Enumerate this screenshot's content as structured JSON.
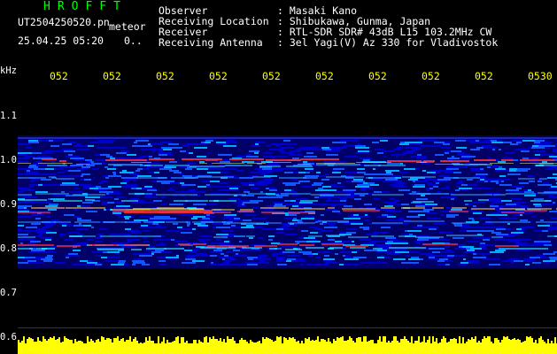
{
  "header": {
    "brand": "HROFFT",
    "filename": "UT2504250520.pn",
    "mode": "meteor",
    "datetime": "25.04.25 05:20",
    "zero_field": "0..",
    "fields": [
      {
        "label": "Observer",
        "value": ": Masaki Kano"
      },
      {
        "label": "Receiving Location",
        "value": ": Shibukawa, Gunma, Japan"
      },
      {
        "label": "Receiver",
        "value": ": RTL-SDR SDR# 43dB L15 103.2MHz CW"
      },
      {
        "label": "Receiving Antenna",
        "value": ": 3el Yagi(V) Az 330 for Vladivostok"
      }
    ]
  },
  "axis": {
    "unit": "kHz",
    "y_ticks": [
      "1.1",
      "1.0",
      "0.9",
      "0.8",
      "0.7",
      "0.6"
    ],
    "x_ticks": [
      "052",
      "052",
      "052",
      "052",
      "052",
      "052",
      "052",
      "052",
      "052",
      "0530"
    ]
  },
  "colors": {
    "brand": "#00ff00",
    "text": "#ffffff",
    "time_ticks": "#ffff00",
    "background": "#000000",
    "noise_bar": "#ffff00"
  }
}
